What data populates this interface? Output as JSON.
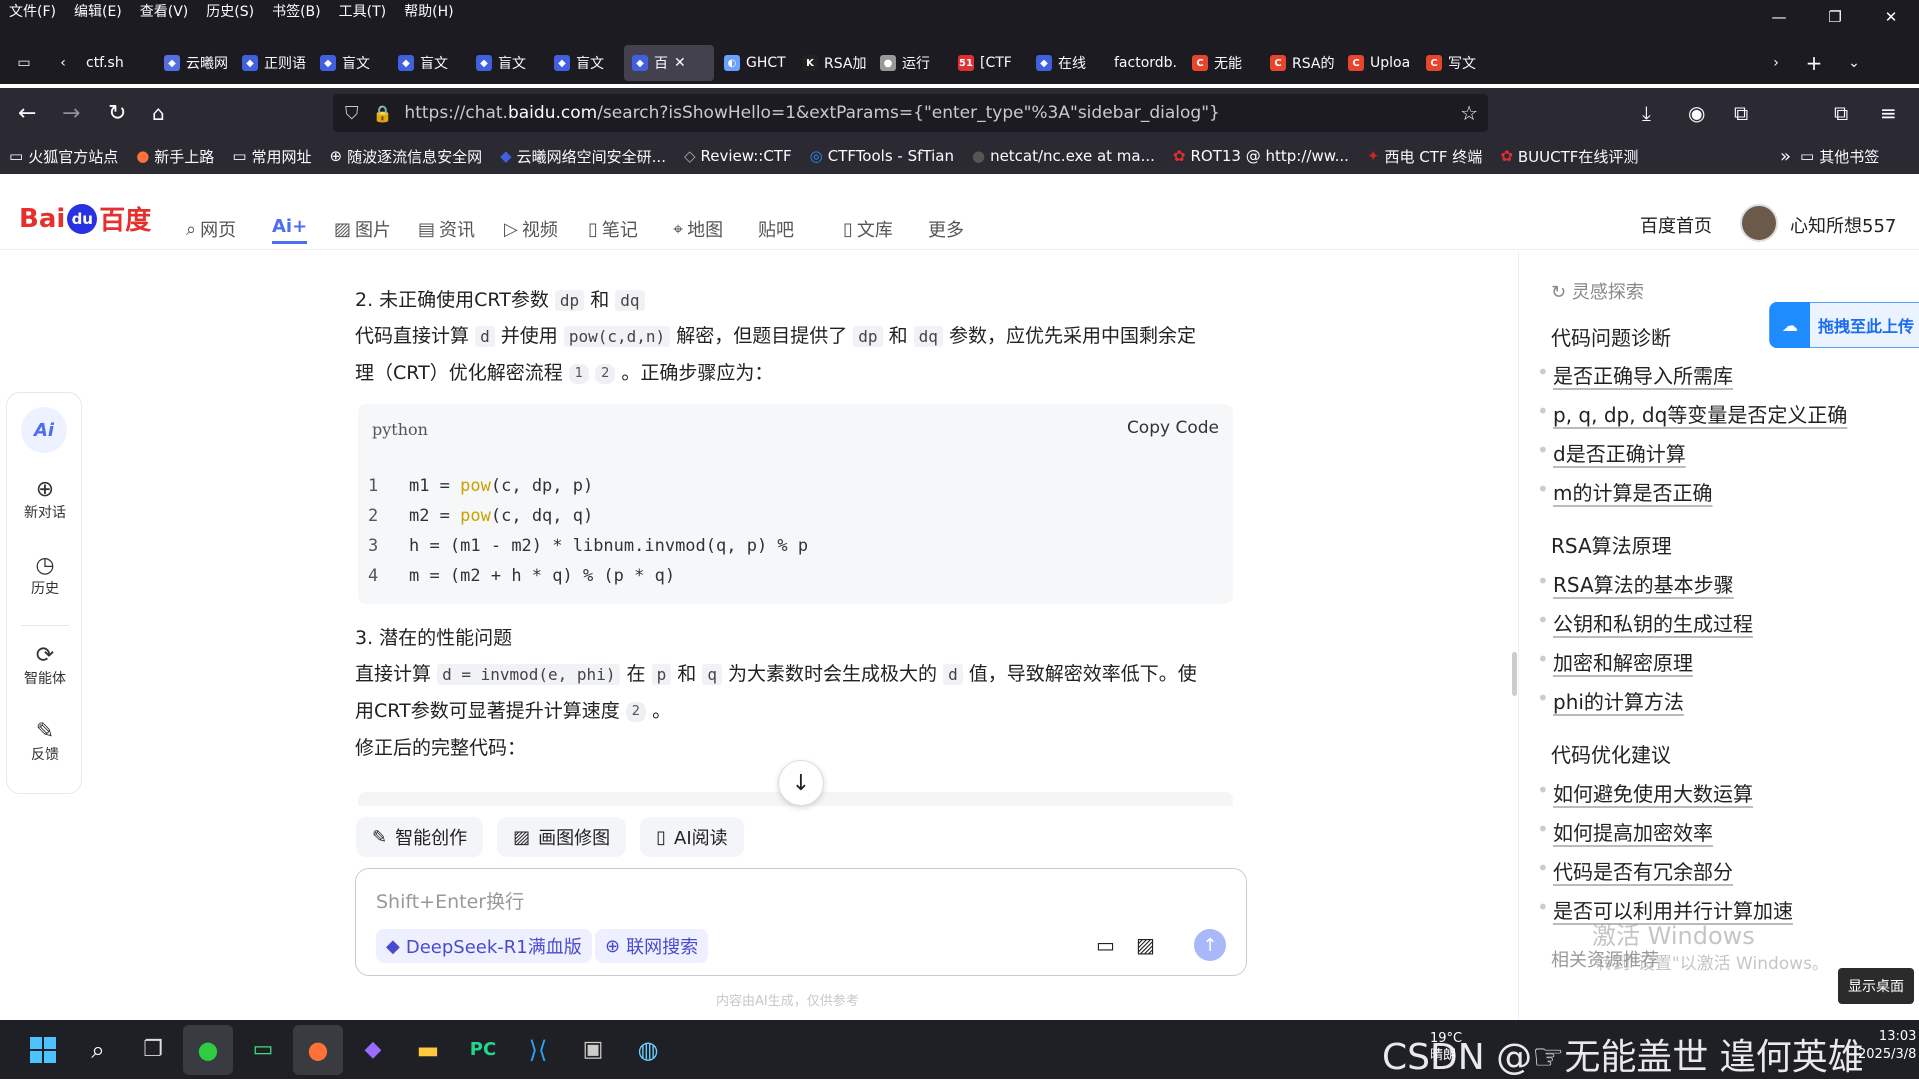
{
  "menubar": {
    "items": [
      "文件(F)",
      "编辑(E)",
      "查看(V)",
      "历史(S)",
      "书签(B)",
      "工具(T)",
      "帮助(H)"
    ]
  },
  "tabs": [
    {
      "label": "ctf.sh",
      "fav": "",
      "color": "#1c1b22"
    },
    {
      "label": "云曦网",
      "fav": "◆",
      "color": "#5470e0"
    },
    {
      "label": "正则语",
      "fav": "◆",
      "color": "#4060e0"
    },
    {
      "label": "盲文",
      "fav": "◆",
      "color": "#4060e0"
    },
    {
      "label": "盲文",
      "fav": "◆",
      "color": "#4060e0"
    },
    {
      "label": "盲文",
      "fav": "◆",
      "color": "#4060e0"
    },
    {
      "label": "盲文",
      "fav": "◆",
      "color": "#4060e0"
    },
    {
      "label": "百",
      "fav": "◆",
      "color": "#4060e0",
      "active": true
    },
    {
      "label": "GHCT",
      "fav": "◐",
      "color": "#6aa0ff"
    },
    {
      "label": "RSA加",
      "fav": "K",
      "color": "#222"
    },
    {
      "label": "运行",
      "fav": "●",
      "color": "#999"
    },
    {
      "label": "[CTF",
      "fav": "51",
      "color": "#e03030"
    },
    {
      "label": "在线",
      "fav": "◆",
      "color": "#4060e0"
    },
    {
      "label": "factordb.",
      "fav": "",
      "color": "#1c1b22"
    },
    {
      "label": "无能",
      "fav": "C",
      "color": "#e8452c"
    },
    {
      "label": "RSA的",
      "fav": "C",
      "color": "#e8452c"
    },
    {
      "label": "Uploa",
      "fav": "C",
      "color": "#e8452c"
    },
    {
      "label": "写文",
      "fav": "C",
      "color": "#e8452c"
    }
  ],
  "url": {
    "prefix": "https://chat.",
    "domain": "baidu.com",
    "path": "/search?isShowHello=1&extParams={\"enter_type\"%3A\"sidebar_dialog\"}"
  },
  "bookmarks": [
    {
      "label": "火狐官方站点",
      "icon": "folder"
    },
    {
      "label": "新手上路",
      "icon": "firefox"
    },
    {
      "label": "常用网址",
      "icon": "folder"
    },
    {
      "label": "随波逐流信息安全网",
      "icon": "globe"
    },
    {
      "label": "云曦网络空间安全研...",
      "icon": "blue"
    },
    {
      "label": "Review::CTF",
      "icon": "grey"
    },
    {
      "label": "CTFTools - SfTian",
      "icon": "ring"
    },
    {
      "label": "netcat/nc.exe at ma...",
      "icon": "dark"
    },
    {
      "label": "ROT13 @ http://ww...",
      "icon": "red"
    },
    {
      "label": "西电 CTF 终端",
      "icon": "bird"
    },
    {
      "label": "BUUCTF在线评测",
      "icon": "red"
    }
  ],
  "other_bookmarks": "其他书签",
  "baidu": {
    "logo_text": "百度",
    "nav": [
      "网页",
      "Ai+",
      "图片",
      "资讯",
      "视频",
      "笔记",
      "地图",
      "贴吧",
      "文库",
      "更多"
    ],
    "home_link": "百度首页",
    "username": "心知所想557"
  },
  "left_sidebar": {
    "items": [
      "新对话",
      "历史",
      "智能体",
      "反馈"
    ]
  },
  "content": {
    "h2": "2. 未正确使用CRT参数",
    "h2_codes": [
      "dp",
      "dq"
    ],
    "p1_a": "代码直接计算",
    "p1_c1": "d",
    "p1_b": "并使用",
    "p1_c2": "pow(c,d,n)",
    "p1_c": "解密，但题目提供了",
    "p1_c3": "dp",
    "p1_d": "和",
    "p1_c4": "dq",
    "p1_e": "参数，应优先采用中国剩余定",
    "p1_f": "理（CRT）优化解密流程",
    "p1_end": "。正确步骤应为：",
    "code_lang": "python",
    "copy_label": "Copy Code",
    "code_lines": [
      {
        "n": "1",
        "pre": "m1 = ",
        "fn": "pow",
        "post": "(c, dp, p)"
      },
      {
        "n": "2",
        "pre": "m2 = ",
        "fn": "pow",
        "post": "(c, dq, q)"
      },
      {
        "n": "3",
        "pre": "h = (m1 - m2) * libnum.invmod(q, p) % p",
        "fn": "",
        "post": ""
      },
      {
        "n": "4",
        "pre": "m = (m2 + h * q) % (p * q)",
        "fn": "",
        "post": ""
      }
    ],
    "h3": "3. 潜在的性能问题",
    "p2_a": "直接计算",
    "p2_c1": "d = invmod(e, phi)",
    "p2_b": "在",
    "p2_c2": "p",
    "p2_c": "和",
    "p2_c3": "q",
    "p2_d": "为大素数时会生成极大的",
    "p2_c4": "d",
    "p2_e": "值，导致解密效率低下。使",
    "p2_f": "用CRT参数可显著提升计算速度",
    "p2_end": "。",
    "p3": "修正后的完整代码："
  },
  "tools": [
    "智能创作",
    "画图修图",
    "AI阅读"
  ],
  "input": {
    "placeholder": "Shift+Enter换行",
    "model": "DeepSeek-R1满血版",
    "web_search": "联网搜索",
    "disclaimer": "内容由AI生成，仅供参考"
  },
  "right_panel": {
    "title": "灵感探索",
    "upload_label": "拖拽至此上传",
    "sections": [
      {
        "title": "代码问题诊断",
        "items": [
          "是否正确导入所需库",
          "p, q, dp, dq等变量是否定义正确",
          "d是否正确计算",
          "m的计算是否正确"
        ]
      },
      {
        "title": "RSA算法原理",
        "items": [
          "RSA算法的基本步骤",
          "公钥和私钥的生成过程",
          "加密和解密原理",
          "phi的计算方法"
        ]
      },
      {
        "title": "代码优化建议",
        "items": [
          "如何避免使用大数运算",
          "如何提高加密效率",
          "代码是否有冗余部分",
          "是否可以利用并行计算加速"
        ]
      }
    ],
    "related": "相关资源推荐"
  },
  "overlays": {
    "watermark1": "激活 Windows",
    "watermark2": "转到\"设置\"以激活 Windows。",
    "show_desktop": "显示桌面",
    "csdn": "CSDN @☞无能盖世 遑何英雄",
    "weather_temp": "19°C",
    "weather": "晴朗",
    "clock": "13:03",
    "date": "2025/3/8"
  }
}
